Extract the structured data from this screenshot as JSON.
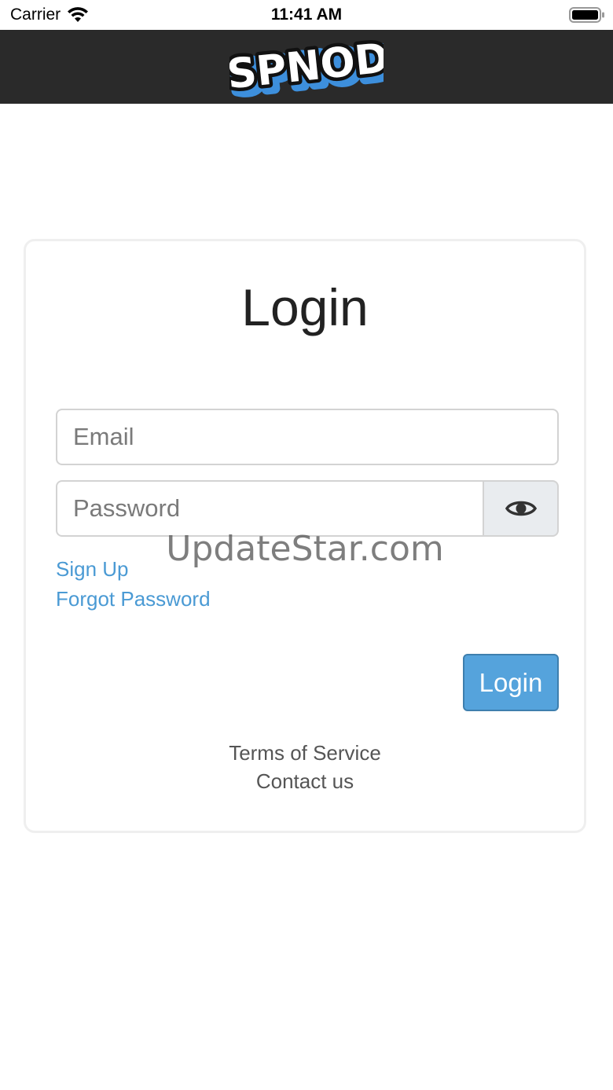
{
  "status_bar": {
    "carrier": "Carrier",
    "time": "11:41 AM",
    "icons": [
      "wifi-icon",
      "battery-icon"
    ]
  },
  "navbar": {
    "logo_text": "SPNOD",
    "logo_colors": {
      "fill": "#ffffff",
      "outline": "#111111",
      "shadow": "#3d8fdc"
    }
  },
  "login_card": {
    "title": "Login",
    "email": {
      "placeholder": "Email",
      "value": ""
    },
    "password": {
      "placeholder": "Password",
      "value": ""
    },
    "show_password_icon": "eye-icon",
    "sign_up_label": "Sign Up",
    "forgot_password_label": "Forgot Password",
    "login_button_label": "Login",
    "terms_label": "Terms of Service",
    "contact_label": "Contact us"
  },
  "watermark": "UpdateStar.com",
  "colors": {
    "navbar_bg": "#2a2a2a",
    "link": "#4a9ad4",
    "login_button": "#55a3dc",
    "card_border": "#efefef"
  }
}
